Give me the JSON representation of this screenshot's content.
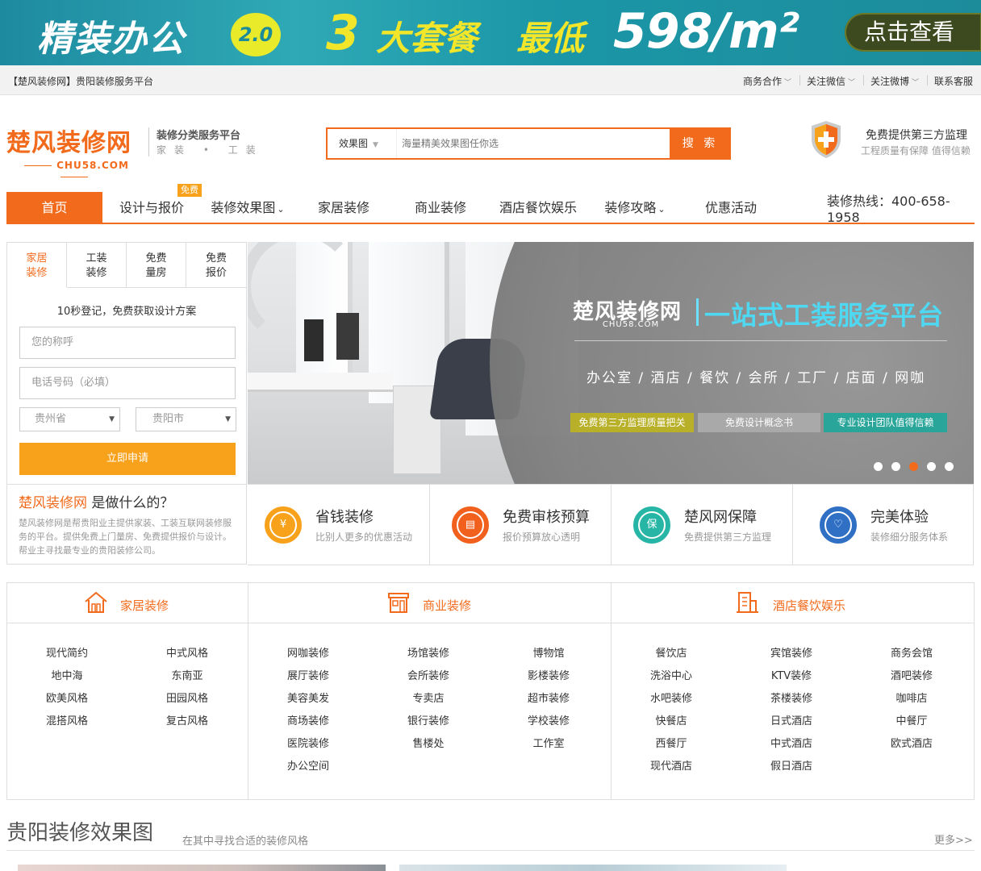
{
  "banner": {
    "title": "精装办公",
    "version": "2.0",
    "package": "大套餐",
    "lowest": "最低",
    "price": "598/m²",
    "cta": "点击查看"
  },
  "util": {
    "site_label": "【楚风装修网】贵阳装修服务平台",
    "links": [
      "商务合作",
      "关注微信",
      "关注微博",
      "联系客服"
    ]
  },
  "header": {
    "logo_name": "楚风装修网",
    "logo_domain": "CHU58.COM",
    "tagline": "装修分类服务平台",
    "tagline_sub": "家装 • 工装",
    "search_type": "效果图",
    "search_placeholder": "海量精美效果图任你选",
    "search_button": "搜 索",
    "supervision_title": "免费提供第三方监理",
    "supervision_sub": "工程质量有保障  值得信赖"
  },
  "nav": {
    "items": [
      "首页",
      "设计与报价",
      "装修效果图",
      "家居装修",
      "商业装修",
      "酒店餐饮娱乐",
      "装修攻略",
      "优惠活动"
    ],
    "badge": "免费",
    "hotline": "装修热线：400-658-1958"
  },
  "form": {
    "tabs": [
      [
        "家居",
        "装修"
      ],
      [
        "工装",
        "装修"
      ],
      [
        "免费",
        "量房"
      ],
      [
        "免费",
        "报价"
      ]
    ],
    "hint": "10秒登记，免费获取设计方案",
    "name_placeholder": "您的称呼",
    "phone_placeholder": "电话号码（必填）",
    "province": "贵州省",
    "city": "贵阳市",
    "submit": "立即申请",
    "about_brand": "楚风装修网",
    "about_q": " 是做什么的？",
    "about_desc": "楚风装修网是帮贵阳业主提供家装、工装互联网装修服务的平台。提供免费上门量房、免费提供报价与设计。帮业主寻找最专业的贵阳装修公司。"
  },
  "slider": {
    "logo": "楚风装修网",
    "domain": "CHU58.COM",
    "title": "一站式工装服务平台",
    "categories": "办公室 / 酒店 / 餐饮 / 会所 / 工厂 / 店面 / 网咖",
    "badges": [
      "免费第三方监理质量把关",
      "免费设计概念书",
      "专业设计团队值得信赖"
    ],
    "active_slide": 3,
    "slide_count": 5
  },
  "features": [
    {
      "title": "省钱装修",
      "desc": "比别人更多的优惠活动",
      "icon": "home-money-icon",
      "color": "#f8a21b"
    },
    {
      "title": "免费审核预算",
      "desc": "报价预算放心透明",
      "icon": "document-icon",
      "color": "#f2601d"
    },
    {
      "title": "楚风网保障",
      "desc": "免费提供第三方监理",
      "icon": "shield-icon",
      "color": "#27b6a5"
    },
    {
      "title": "完美体验",
      "desc": "装修细分服务体系",
      "icon": "heart-icon",
      "color": "#2f6fc4"
    }
  ],
  "categories": {
    "home": {
      "title": "家居装修",
      "links": [
        "现代简约",
        "中式风格",
        "地中海",
        "东南亚",
        "欧美风格",
        "田园风格",
        "混搭风格",
        "复古风格"
      ]
    },
    "commercial": {
      "title": "商业装修",
      "links": [
        "网咖装修",
        "场馆装修",
        "博物馆",
        "展厅装修",
        "会所装修",
        "影楼装修",
        "美容美发",
        "专卖店",
        "超市装修",
        "商场装修",
        "银行装修",
        "学校装修",
        "医院装修",
        "售楼处",
        "工作室",
        "办公空间"
      ]
    },
    "hotel": {
      "title": "酒店餐饮娱乐",
      "links": [
        "餐饮店",
        "宾馆装修",
        "商务会馆",
        "洗浴中心",
        "KTV装修",
        "酒吧装修",
        "水吧装修",
        "茶楼装修",
        "咖啡店",
        "快餐店",
        "日式酒店",
        "中餐厅",
        "西餐厅",
        "中式酒店",
        "欧式酒店",
        "现代酒店",
        "假日酒店"
      ]
    }
  },
  "section": {
    "title": "贵阳装修效果图",
    "subtitle": "在其中寻找合适的装修风格",
    "more": "更多>>"
  }
}
